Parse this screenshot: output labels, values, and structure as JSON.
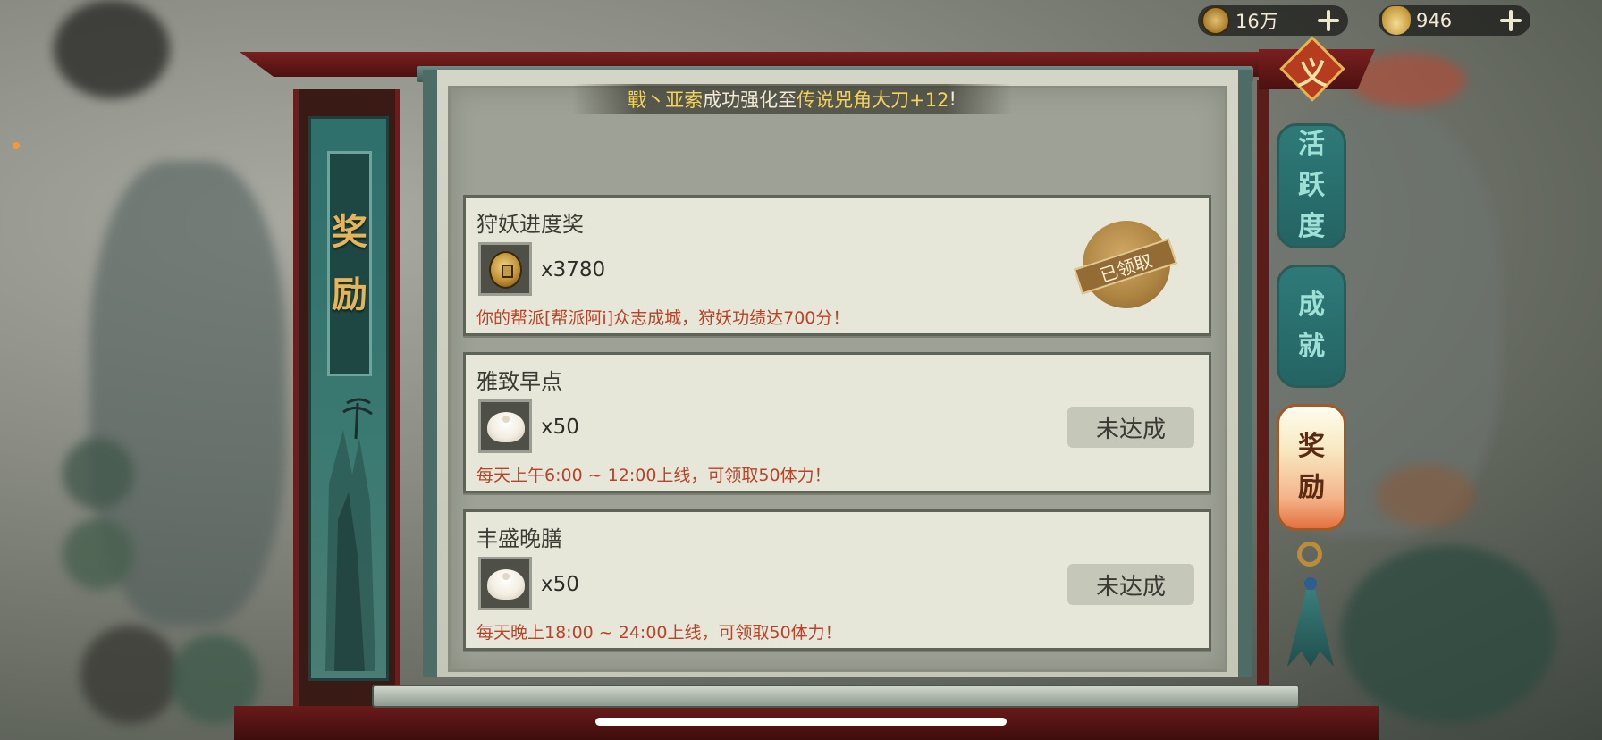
{
  "resources": [
    {
      "icon": "copper-coin-icon",
      "value": "16万"
    },
    {
      "icon": "gold-ingot-icon",
      "value": "946"
    }
  ],
  "banner": {
    "char1": "奖",
    "char2": "励"
  },
  "marquee": {
    "name": "戰丶亚索",
    "mid": "成功强化至",
    "item": "传说兕角大刀+12",
    "end": "!"
  },
  "rewards": [
    {
      "title": "狩妖进度奖",
      "icon": "copper-coin-icon",
      "qty": "x3780",
      "desc": "你的帮派[帮派阿i]众志成城，狩妖功绩达700分！",
      "status": "已领取"
    },
    {
      "title": "雅致早点",
      "icon": "steamed-bun-icon",
      "qty": "x50",
      "desc": "每天上午6:00 ~ 12:00上线，可领取50体力！",
      "status": "未达成"
    },
    {
      "title": "丰盛晚膳",
      "icon": "steamed-bun-icon",
      "qty": "x50",
      "desc": "每天晚上18:00 ~ 24:00上线，可领取50体力！",
      "status": "未达成"
    }
  ],
  "emblem": "义",
  "side_tabs": [
    {
      "c1": "活",
      "c2": "跃",
      "c3": "度"
    },
    {
      "c1": "成",
      "c2": "就"
    },
    {
      "c1": "奖",
      "c2": "励",
      "active": true
    }
  ],
  "colors": {
    "accent_gold": "#f3d25a",
    "teal": "#2e7a79",
    "warning_text": "#b8432a"
  }
}
